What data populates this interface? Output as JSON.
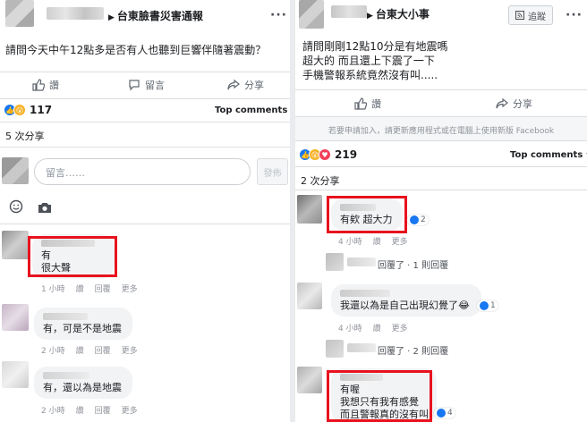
{
  "left_post": {
    "page_name": "台東臉書災害通報",
    "text": "請問今天中午12點多是否有人也聽到巨響伴隨著震動？",
    "actions": {
      "like": "讚",
      "comment": "留言",
      "share": "分享"
    },
    "reaction_count": "117",
    "top_comments": "Top comments",
    "shares": "5 次分享",
    "comment_placeholder": "留言……",
    "post_button": "發佈",
    "comments": [
      {
        "lines": [
          "有",
          "很大聲"
        ],
        "meta": [
          "1 小時",
          "讚",
          "回覆",
          "更多"
        ]
      },
      {
        "lines": [
          "有，可是不是地震"
        ],
        "meta": [
          "2 小時",
          "讚",
          "回覆",
          "更多"
        ]
      },
      {
        "lines": [
          "有，還以為是地震"
        ],
        "meta": [
          "2 小時",
          "讚",
          "回覆",
          "更多"
        ]
      }
    ]
  },
  "right_post": {
    "page_name": "台東大小事",
    "follow_label": "追蹤",
    "text_lines": [
      "請問剛剛12點10分是有地震嗎",
      "超大的 而且還上下震了一下",
      "手機警報系統竟然沒有叫....."
    ],
    "actions": {
      "like": "讚",
      "share": "分享"
    },
    "notice": "若要申請加入，請更新應用程式或在電腦上使用新版 Facebook",
    "reaction_count": "219",
    "top_comments": "Top comments",
    "shares": "2 次分享",
    "comments": [
      {
        "lines": [
          "有欸 超大力"
        ],
        "badge": "2",
        "meta": [
          "4 小時",
          "讚",
          "更多"
        ]
      },
      {
        "reply": "回覆了 · 1 則回覆"
      },
      {
        "lines": [
          "我還以為是自己出現幻覺了😂"
        ],
        "badge": "1",
        "meta": [
          "4 小時",
          "讚",
          "更多"
        ]
      },
      {
        "reply": "回覆了 · 2 則回覆"
      },
      {
        "lines": [
          "有喔",
          "我想只有我有感覺",
          "而且警報真的沒有叫"
        ],
        "badge": "4"
      }
    ]
  },
  "colors": {
    "highlight": "#e8121e",
    "like_blue": "#1877f2",
    "love_red": "#f33e58",
    "wow_yellow": "#f7b125"
  }
}
